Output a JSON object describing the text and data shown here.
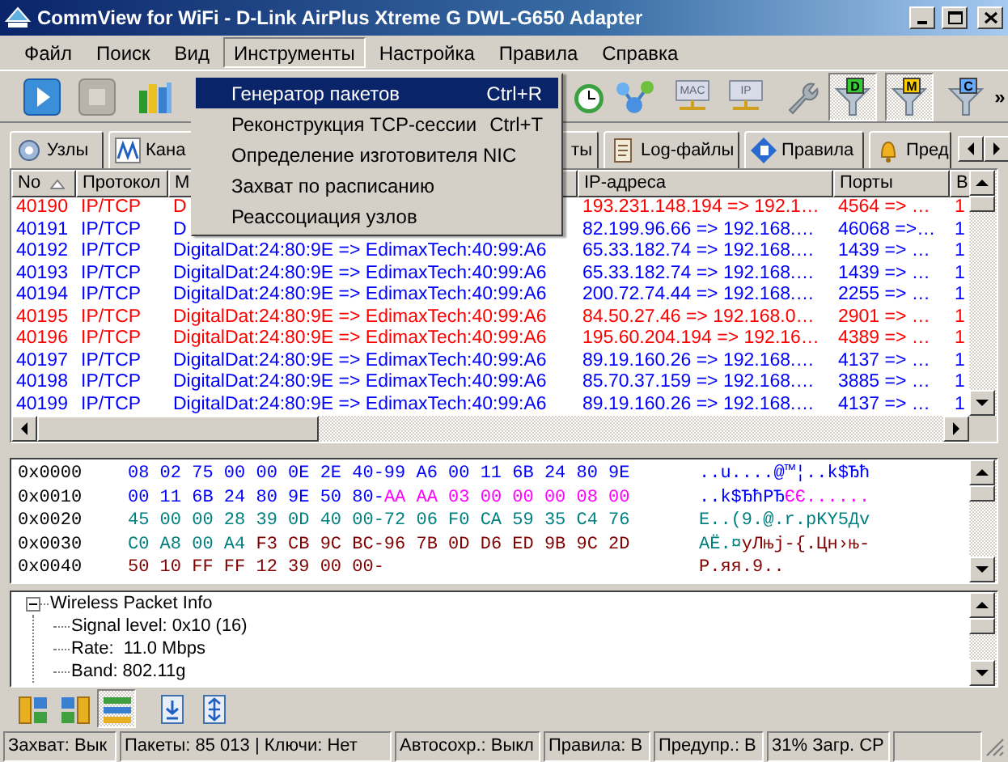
{
  "window": {
    "title": "CommView for WiFi - D-Link AirPlus Xtreme G DWL-G650 Adapter"
  },
  "menu_bar": [
    {
      "label": "Файл",
      "selected": false
    },
    {
      "label": "Поиск",
      "selected": false
    },
    {
      "label": "Вид",
      "selected": false
    },
    {
      "label": "Инструменты",
      "selected": true
    },
    {
      "label": "Настройка",
      "selected": false
    },
    {
      "label": "Правила",
      "selected": false
    },
    {
      "label": "Справка",
      "selected": false
    }
  ],
  "open_menu": {
    "items": [
      {
        "label": "Генератор пакетов",
        "shortcut": "Ctrl+R",
        "selected": true
      },
      {
        "label": "Реконструкция TCP-сессии",
        "shortcut": "Ctrl+T",
        "selected": false
      },
      {
        "label": "Определение изготовителя NIC",
        "selected": false
      },
      {
        "label": "Захват по расписанию",
        "selected": false
      },
      {
        "label": "Реассоциация узлов",
        "selected": false
      }
    ]
  },
  "toolbar": [
    {
      "kind": "play",
      "pressed": false
    },
    {
      "kind": "stop",
      "pressed": false
    },
    {
      "kind": "columns",
      "pressed": false
    },
    {
      "kind": "clock",
      "pressed": false
    },
    {
      "kind": "nodes",
      "pressed": false
    },
    {
      "kind": "tag",
      "label": "MAC",
      "pressed": false
    },
    {
      "kind": "tag",
      "label": "IP",
      "pressed": false
    },
    {
      "kind": "wrench",
      "pressed": false
    },
    {
      "kind": "filter",
      "label": "D",
      "color": "#33cc33",
      "pressed": true
    },
    {
      "kind": "filter",
      "label": "M",
      "color": "#ffcc00",
      "pressed": true
    },
    {
      "kind": "filter",
      "label": "C",
      "color": "#66aaff",
      "pressed": false
    },
    {
      "kind": "more",
      "label": "»"
    }
  ],
  "tabs": [
    {
      "label": "Узлы",
      "kind": "nodes",
      "selected": false
    },
    {
      "label": "Кана",
      "kind": "wave",
      "selected": false
    },
    {
      "label": "ты",
      "kind": "plain",
      "selected": false
    },
    {
      "label": "Log-файлы",
      "kind": "scroll",
      "selected": false
    },
    {
      "label": "Правила",
      "kind": "rules",
      "selected": false
    },
    {
      "label": "Пред",
      "kind": "bell",
      "selected": false
    }
  ],
  "packet_table": {
    "columns": [
      {
        "label": "No",
        "sorted": true
      },
      {
        "label": "Протокол"
      },
      {
        "label": "M"
      },
      {
        "label": "IP-адреса"
      },
      {
        "label": "Порты"
      },
      {
        "label": "B"
      }
    ],
    "rows": [
      {
        "no": "40190",
        "protocol": "IP/TCP",
        "mac": "D",
        "ip": "193.231.148.194 => 192.1…",
        "ports": "4564 => …",
        "column_6": "1",
        "color": "#ff0000"
      },
      {
        "no": "40191",
        "protocol": "IP/TCP",
        "mac": "D",
        "ip": "82.199.96.66 => 192.168.…",
        "ports": "46068 =>…",
        "column_6": "1",
        "color": "#0000ff"
      },
      {
        "no": "40192",
        "protocol": "IP/TCP",
        "mac": "DigitalDat:24:80:9E => EdimaxTech:40:99:A6",
        "ip": "65.33.182.74 => 192.168.…",
        "ports": "1439 => …",
        "column_6": "1",
        "color": "#0000ff"
      },
      {
        "no": "40193",
        "protocol": "IP/TCP",
        "mac": "DigitalDat:24:80:9E => EdimaxTech:40:99:A6",
        "ip": "65.33.182.74 => 192.168.…",
        "ports": "1439 => …",
        "column_6": "1",
        "color": "#0000ff"
      },
      {
        "no": "40194",
        "protocol": "IP/TCP",
        "mac": "DigitalDat:24:80:9E => EdimaxTech:40:99:A6",
        "ip": "200.72.74.44 => 192.168.…",
        "ports": "2255 => …",
        "column_6": "1",
        "color": "#0000ff"
      },
      {
        "no": "40195",
        "protocol": "IP/TCP",
        "mac": "DigitalDat:24:80:9E => EdimaxTech:40:99:A6",
        "ip": "84.50.27.46 => 192.168.0…",
        "ports": "2901 => …",
        "column_6": "1",
        "color": "#ff0000"
      },
      {
        "no": "40196",
        "protocol": "IP/TCP",
        "mac": "DigitalDat:24:80:9E => EdimaxTech:40:99:A6",
        "ip": "195.60.204.194 => 192.16…",
        "ports": "4389 => …",
        "column_6": "1",
        "color": "#ff0000"
      },
      {
        "no": "40197",
        "protocol": "IP/TCP",
        "mac": "DigitalDat:24:80:9E => EdimaxTech:40:99:A6",
        "ip": "89.19.160.26 => 192.168.…",
        "ports": "4137 => …",
        "column_6": "1",
        "color": "#0000ff"
      },
      {
        "no": "40198",
        "protocol": "IP/TCP",
        "mac": "DigitalDat:24:80:9E => EdimaxTech:40:99:A6",
        "ip": "85.70.37.159 => 192.168.…",
        "ports": "3885 => …",
        "column_6": "1",
        "color": "#0000ff"
      },
      {
        "no": "40199",
        "protocol": "IP/TCP",
        "mac": "DigitalDat:24:80:9E => EdimaxTech:40:99:A6",
        "ip": "89.19.160.26 => 192.168.…",
        "ports": "4137 => …",
        "column_6": "1",
        "color": "#0000ff"
      }
    ]
  },
  "hex_dump": [
    {
      "offset": "0x0000",
      "hex": [
        {
          "text": "08 02 75 00 00 0E 2E 40-99 A6 00 11 6B 24 80 9E",
          "color": "#0000ff"
        }
      ],
      "ascii": [
        {
          "text": "..u....@™¦..k$Ђћ",
          "color": "#0000ff"
        }
      ]
    },
    {
      "offset": "0x0010",
      "hex": [
        {
          "text": "00 11 6B 24 80 9E 50 80-",
          "color": "#0000ff"
        },
        {
          "text": "AA AA 03 00 00 00 08 00",
          "color": "#ff00ff"
        }
      ],
      "ascii": [
        {
          "text": "..k$ЂћPЂ",
          "color": "#0000ff"
        },
        {
          "text": "ЄЄ......",
          "color": "#ff00ff"
        }
      ]
    },
    {
      "offset": "0x0020",
      "hex": [
        {
          "text": "45 00 00 28 39 0D 40 00-72 06 F0 CA 59 35 C4 76",
          "color": "#008080"
        }
      ],
      "ascii": [
        {
          "text": "E..(9.@.r.pKY5Дv",
          "color": "#008080"
        }
      ]
    },
    {
      "offset": "0x0030",
      "hex": [
        {
          "text": "C0 A8 00 A4 ",
          "color": "#008080"
        },
        {
          "text": "F3 CB 9C BC-96 7B 0D D6 ED 9B 9C 2D",
          "color": "#800000"
        }
      ],
      "ascii": [
        {
          "text": "АЁ.¤",
          "color": "#008080"
        },
        {
          "text": "уЛњј-{.Цн›њ-",
          "color": "#800000"
        }
      ]
    },
    {
      "offset": "0x0040",
      "hex": [
        {
          "text": "50 10 FF FF 12 39 00 00-",
          "color": "#800000"
        }
      ],
      "ascii": [
        {
          "text": "P.яя.9..",
          "color": "#800000"
        }
      ]
    }
  ],
  "details_tree": [
    {
      "label": "Wireless Packet Info",
      "expanded": true,
      "children": [
        {
          "label": "Signal level: 0x10 (16)"
        },
        {
          "label": "Rate:  11.0 Mbps"
        },
        {
          "label": "Band: 802.11g"
        }
      ]
    }
  ],
  "view_toolbar": [
    {
      "kind": "layout-left",
      "selected": false
    },
    {
      "kind": "layout-right",
      "selected": false
    },
    {
      "kind": "layout-rows",
      "selected": true
    },
    {
      "kind": "scroll-down",
      "selected": false
    },
    {
      "kind": "expand",
      "selected": false
    }
  ],
  "status_bar": [
    "Захват: Вык",
    "Пакеты: 85 013 | Ключи: Нет",
    "Автосохр.: Выкл",
    "Правила: В",
    "Предупр.: В",
    "31% Загр. CP"
  ]
}
